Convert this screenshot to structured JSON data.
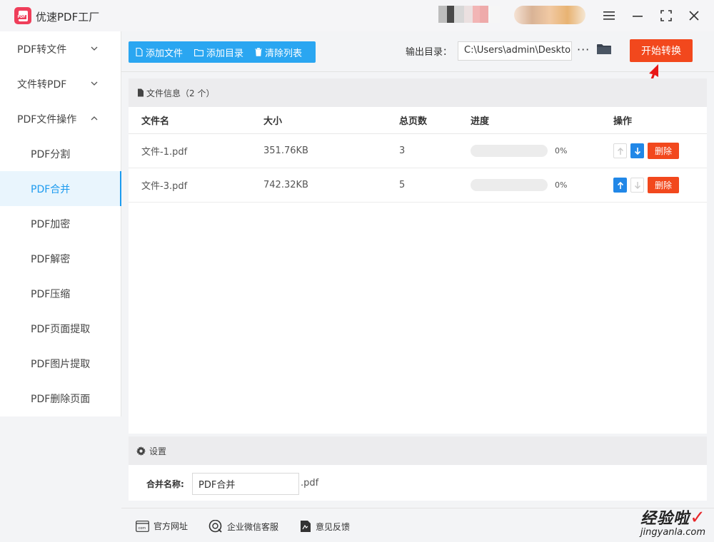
{
  "app": {
    "title": "优速PDF工厂",
    "logo_text": "PDF"
  },
  "sidebar": {
    "groups": [
      {
        "label": "PDF转文件"
      },
      {
        "label": "文件转PDF"
      },
      {
        "label": "PDF文件操作"
      }
    ],
    "items": [
      {
        "label": "PDF分割"
      },
      {
        "label": "PDF合并"
      },
      {
        "label": "PDF加密"
      },
      {
        "label": "PDF解密"
      },
      {
        "label": "PDF压缩"
      },
      {
        "label": "PDF页面提取"
      },
      {
        "label": "PDF图片提取"
      },
      {
        "label": "PDF删除页面"
      }
    ]
  },
  "toolbar": {
    "add_file": "添加文件",
    "add_dir": "添加目录",
    "clear_list": "清除列表",
    "output_label": "输出目录：",
    "output_path": "C:\\Users\\admin\\Deskto",
    "more": "···",
    "start": "开始转换"
  },
  "panel": {
    "title": "文件信息（2 个）",
    "columns": [
      "文件名",
      "大小",
      "总页数",
      "进度",
      "操作"
    ],
    "rows": [
      {
        "name": "文件-1.pdf",
        "size": "351.76KB",
        "pages": "3",
        "progress": "0%",
        "delete": "删除"
      },
      {
        "name": "文件-3.pdf",
        "size": "742.32KB",
        "pages": "5",
        "progress": "0%",
        "delete": "删除"
      }
    ]
  },
  "settings": {
    "title": "设置",
    "merge_label": "合并名称:",
    "merge_value": "PDF合并",
    "merge_ext": ".pdf"
  },
  "footer": {
    "website": "官方网址",
    "wechat": "企业微信客服",
    "feedback": "意见反馈"
  },
  "watermark": {
    "cn": "经验啦",
    "en": "jingyanla.com"
  },
  "colors": {
    "accent": "#2aa6f1",
    "start": "#f2481d",
    "active_bg": "#e9f5fd"
  }
}
